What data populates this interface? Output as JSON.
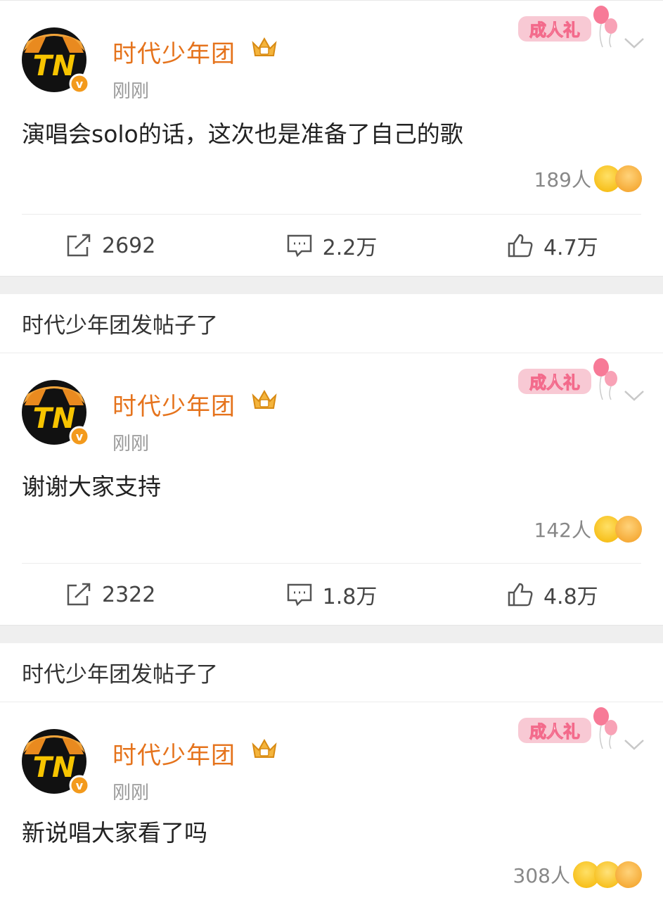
{
  "colors": {
    "username": "#e5731c",
    "background_gap": "#efefef",
    "timestamp": "#9a9a9a",
    "avatar_yellow": "#f7c400",
    "badge_pink": "#f36a8b"
  },
  "icons": {
    "repost": "share-box-icon",
    "comment": "comment-bubble-icon",
    "like": "thumbs-up-icon",
    "more": "chevron-down-icon",
    "vip": "crown-icon",
    "badge": "balloon-badge"
  },
  "posts": [
    {
      "username": "时代少年团",
      "time": "刚刚",
      "badge_text": "成人礼",
      "text": "演唱会solo的话，这次也是准备了自己的歌",
      "reactions": "189人",
      "repost": "2692",
      "comment": "2.2万",
      "like": "4.7万"
    },
    {
      "section_label": "时代少年团发帖子了",
      "username": "时代少年团",
      "time": "刚刚",
      "badge_text": "成人礼",
      "text": "谢谢大家支持",
      "reactions": "142人",
      "repost": "2322",
      "comment": "1.8万",
      "like": "4.8万"
    },
    {
      "section_label": "时代少年团发帖子了",
      "username": "时代少年团",
      "time": "刚刚",
      "badge_text": "成人礼",
      "text": "新说唱大家看了吗",
      "reactions": "308人"
    }
  ]
}
